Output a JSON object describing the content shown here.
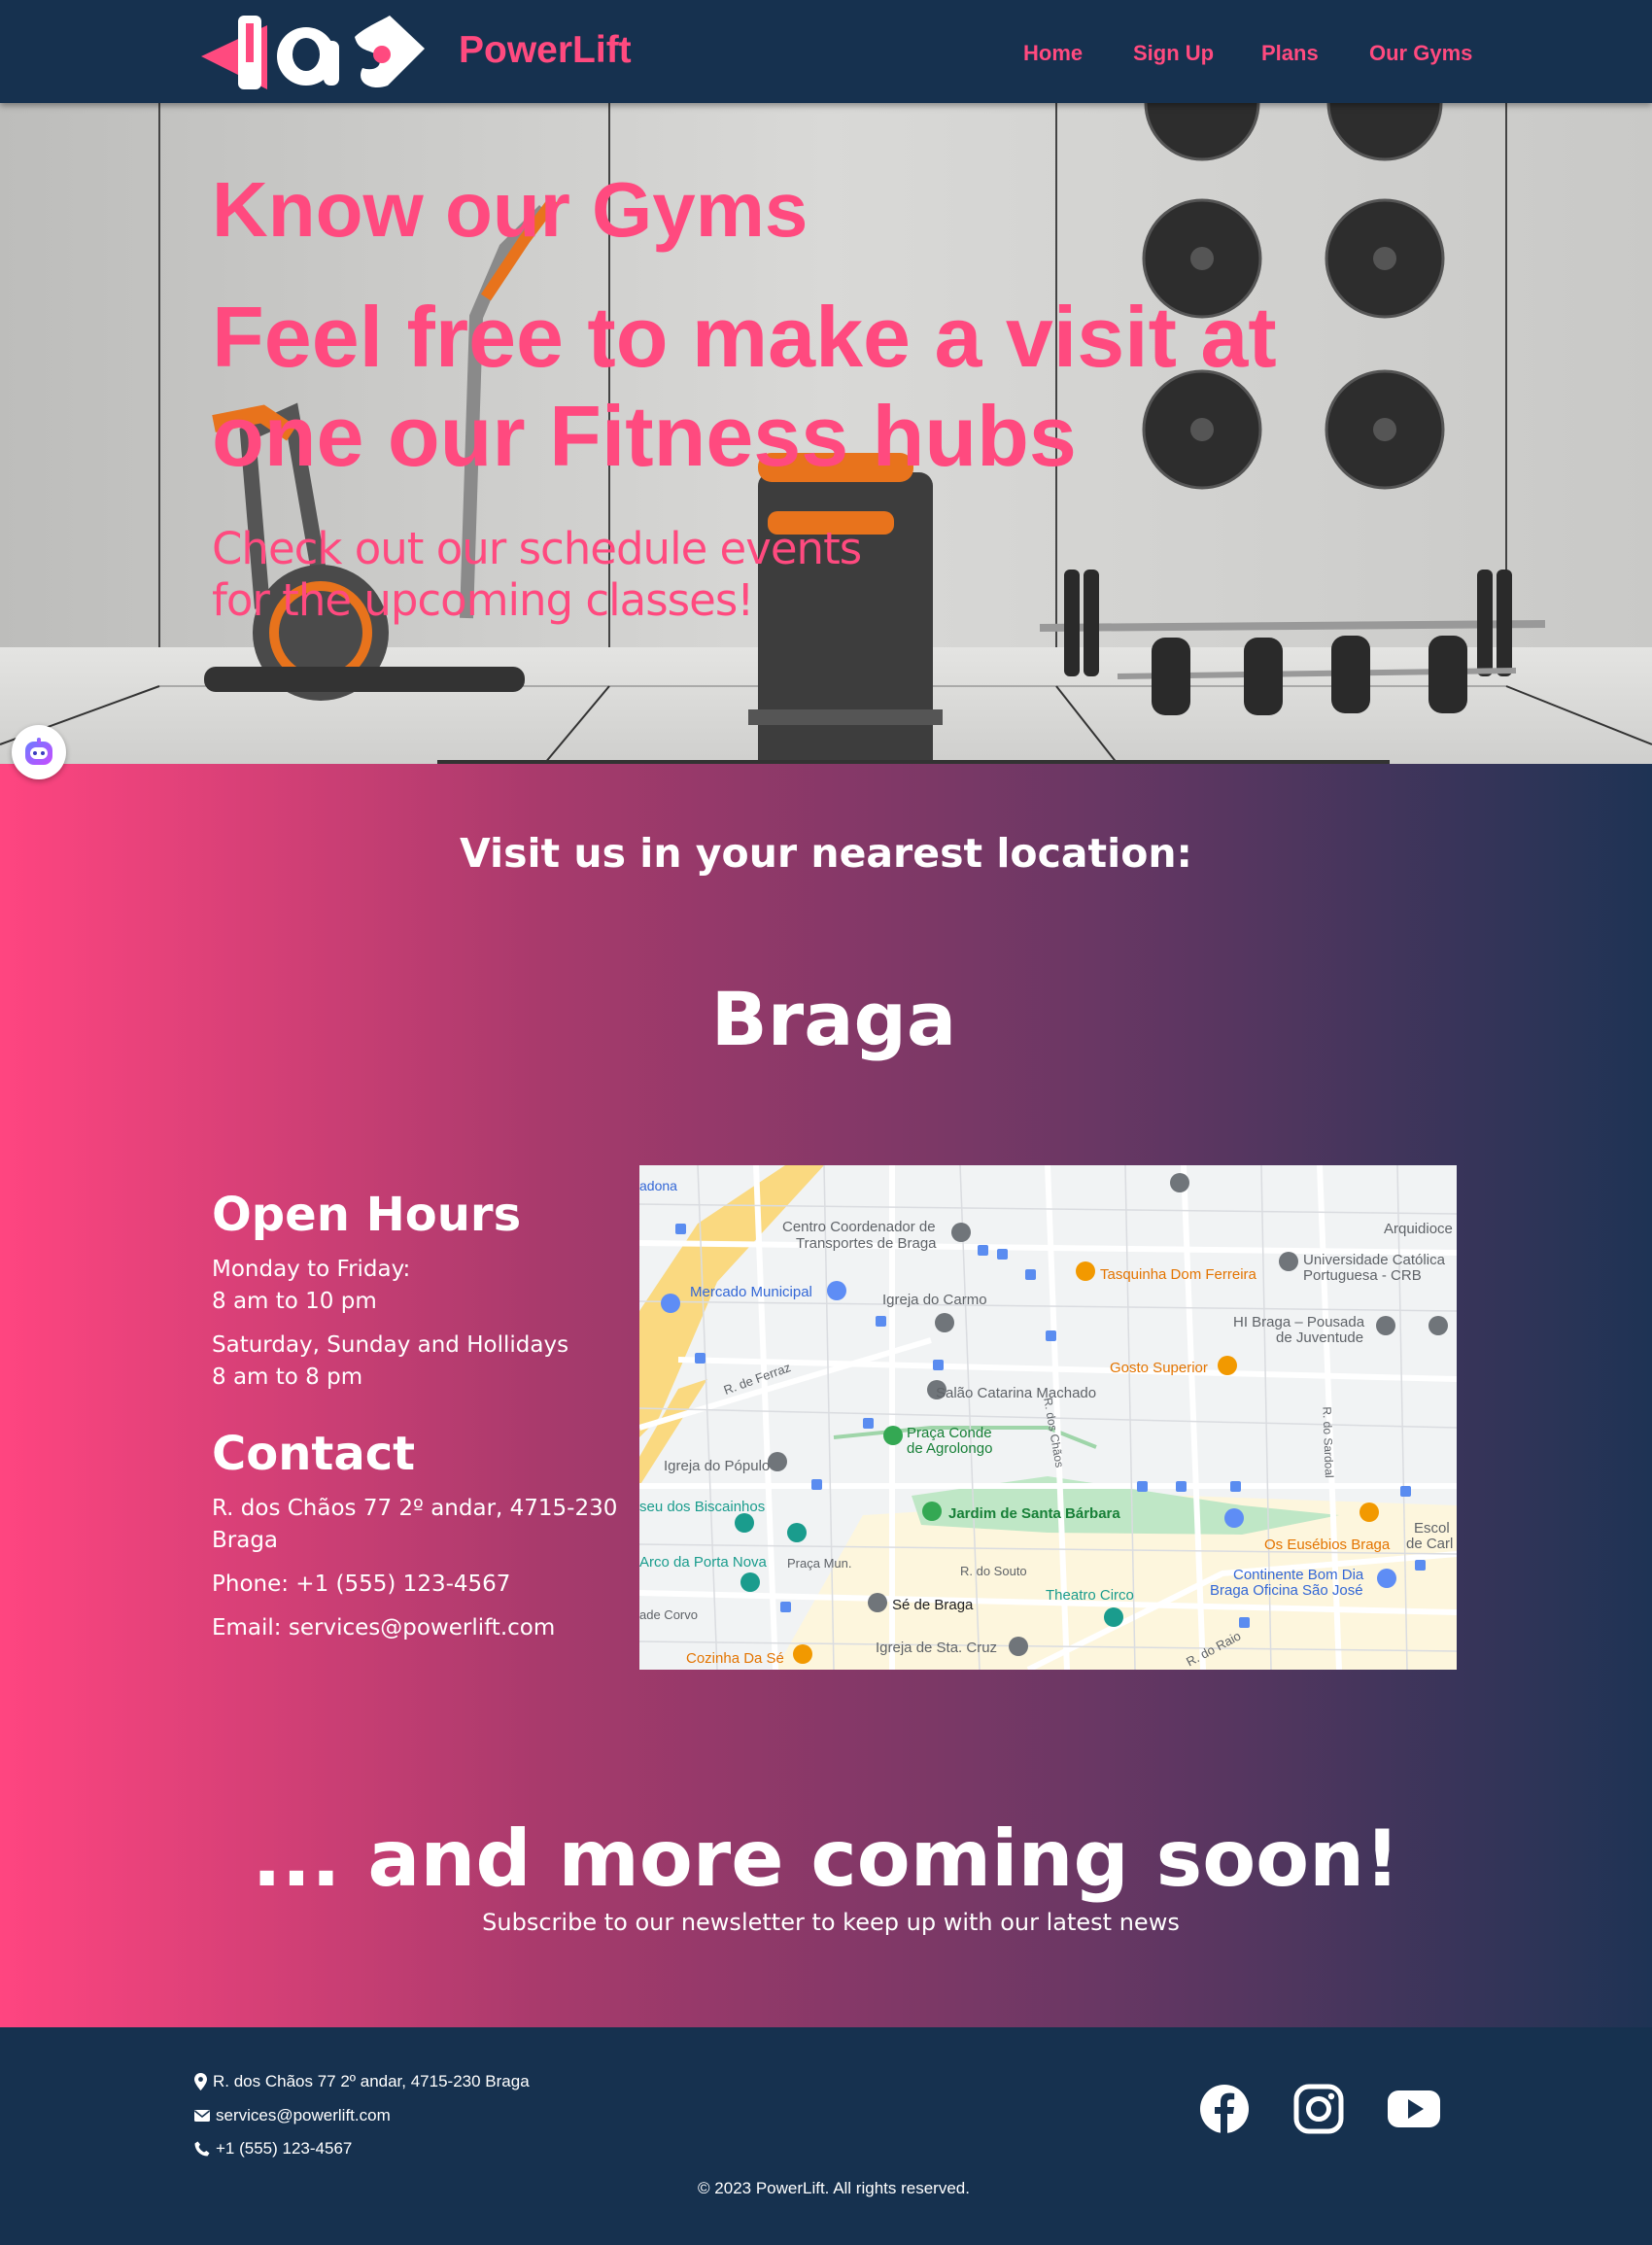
{
  "header": {
    "brand": "PowerLift",
    "nav": [
      "Home",
      "Sign Up",
      "Plans",
      "Our Gyms"
    ]
  },
  "hero": {
    "title": "Know our Gyms",
    "subtitle": "Feel free to make a visit at one our Fitness hubs",
    "text": "Check out our schedule events for the upcoming classes!"
  },
  "main": {
    "visit_heading": "Visit us in your nearest location:",
    "city": "Braga",
    "open_hours_heading": "Open Hours",
    "weekdays_label": "Monday to Friday:",
    "weekdays_hours": "8 am to 10 pm",
    "weekend_label": "Saturday, Sunday and Hollidays",
    "weekend_hours": "8 am to 8 pm",
    "contact_heading": "Contact",
    "address_line1": "R. dos Chãos 77 2º andar, 4715-230",
    "address_line2": "Braga",
    "phone": "Phone: +1 (555) 123-4567",
    "email": "Email: services@powerlift.com",
    "more_heading": "... and more coming soon!",
    "subscribe": "Subscribe to our newsletter to keep up with our latest news"
  },
  "map": {
    "labels": {
      "centro1": "Centro Coordenador de",
      "centro2": "Transportes de Braga",
      "arquidiocese": "Arquidioce",
      "mercado": "Mercado Municipal",
      "igreja_carmo": "Igreja do Carmo",
      "tasquinha": "Tasquinha Dom Ferreira",
      "univ1": "Universidade Católica",
      "univ2": "Portuguesa - CRB",
      "hi1": "HI Braga – Pousada",
      "hi2": "de Juventude",
      "ferraz": "R. de Ferraz",
      "gosto": "Gosto Superior",
      "salao": "Salão Catarina Machado",
      "praca1": "Praça Conde",
      "praca2": "de Agrolongo",
      "igreja_populo": "Igreja do Pópulo",
      "chaos": "R. dos Chãos",
      "sardoal": "R. do Sardoal",
      "biscainhos": "seu dos Biscainhos",
      "jardim": "Jardim de Santa Bárbara",
      "euseb": "Os Eusébios Braga",
      "escola1": "Escol",
      "escola2": "de Carl",
      "arco": "Arco da Porta Nova",
      "praca_mun": "Praça Mun.",
      "souto": "R. do Souto",
      "continente1": "Continente Bom Dia",
      "continente2": "Braga Oficina São José",
      "corvo": "ade Corvo",
      "se": "Sé de Braga",
      "theatro": "Theatro Circo",
      "cozinha": "Cozinha Da Sé",
      "igreja_cruz": "Igreja de Sta. Cruz",
      "raio": "R. do Raio",
      "donona": "adona"
    }
  },
  "footer": {
    "address": "R. dos Chãos 77 2º andar, 4715-230 Braga",
    "email": "services@powerlift.com",
    "phone": "+1 (555) 123-4567",
    "copyright": "© 2023 PowerLift. All rights reserved."
  },
  "icons": [
    "map-marker-icon",
    "envelope-icon",
    "phone-icon",
    "facebook-icon",
    "instagram-icon",
    "youtube-icon",
    "assistant-bot-icon"
  ],
  "colors": {
    "navy": "#16314f",
    "pink": "#ff4a7f"
  }
}
